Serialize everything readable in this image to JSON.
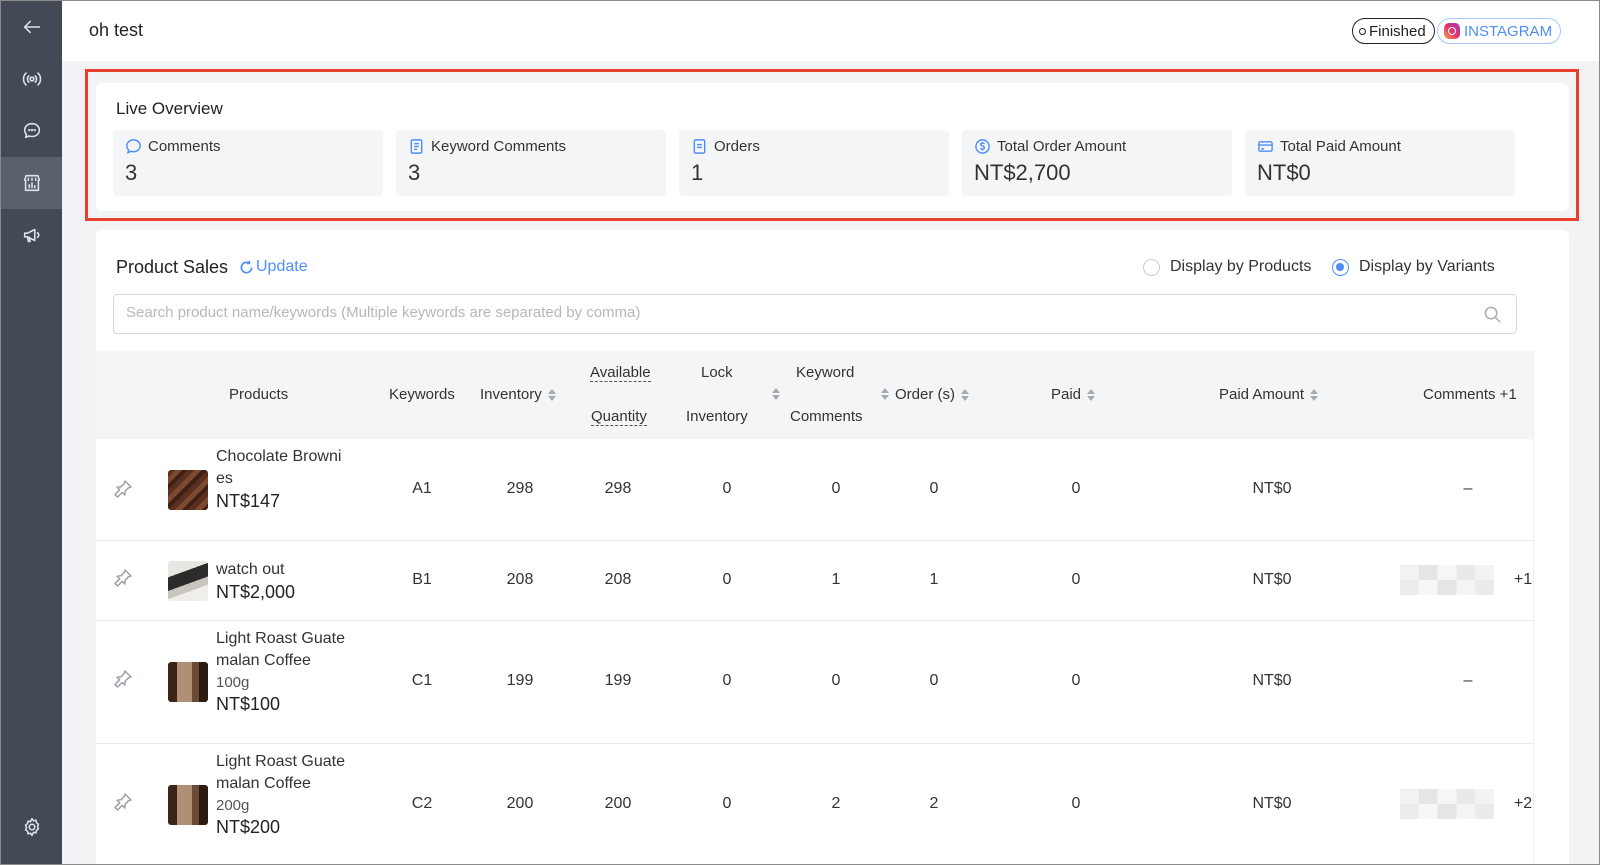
{
  "sidebar": {
    "items": [
      {
        "icon": "back-arrow-icon"
      },
      {
        "icon": "live-broadcast-icon"
      },
      {
        "icon": "chat-icon"
      },
      {
        "icon": "shop-analytics-icon",
        "active": true
      },
      {
        "icon": "megaphone-icon"
      },
      {
        "icon": "gear-icon"
      }
    ]
  },
  "header": {
    "title": "oh test",
    "status": "Finished",
    "platform": "INSTAGRAM"
  },
  "overview": {
    "title": "Live Overview",
    "stats": [
      {
        "label": "Comments",
        "value": "3",
        "icon": "comment-icon"
      },
      {
        "label": "Keyword Comments",
        "value": "3",
        "icon": "document-icon"
      },
      {
        "label": "Orders",
        "value": "1",
        "icon": "order-icon"
      },
      {
        "label": "Total Order Amount",
        "value": "NT$2,700",
        "icon": "dollar-icon"
      },
      {
        "label": "Total Paid Amount",
        "value": "NT$0",
        "icon": "card-icon"
      }
    ]
  },
  "sales": {
    "title": "Product Sales",
    "update_label": "Update",
    "display_by_products": "Display by Products",
    "display_by_variants": "Display by Variants",
    "selected_display": "variants",
    "search_placeholder": "Search product name/keywords (Multiple keywords are separated by comma)",
    "columns": {
      "products": "Products",
      "keywords": "Keywords",
      "inventory": "Inventory",
      "available": "Available",
      "quantity": "Quantity",
      "lock": "Lock",
      "lock_inventory": "Inventory",
      "keyword": "Keyword",
      "keyword_comments": "Comments",
      "orders": "Order (s)",
      "paid": "Paid",
      "paid_amount": "Paid Amount",
      "comments": "Comments +1"
    },
    "rows": [
      {
        "name_1": "Chocolate Browni",
        "name_2": "es",
        "variant": "",
        "price": "NT$147",
        "keyword": "A1",
        "inventory": "298",
        "available": "298",
        "lock": "0",
        "keyword_comments": "0",
        "orders": "0",
        "paid": "0",
        "paid_amount": "NT$0",
        "comments": "–"
      },
      {
        "name_1": "watch out",
        "name_2": "",
        "variant": "",
        "price": "NT$2,000",
        "keyword": "B1",
        "inventory": "208",
        "available": "208",
        "lock": "0",
        "keyword_comments": "1",
        "orders": "1",
        "paid": "0",
        "paid_amount": "NT$0",
        "comments": "+1"
      },
      {
        "name_1": "Light Roast Guate",
        "name_2": "malan Coffee",
        "variant": "100g",
        "price": "NT$100",
        "keyword": "C1",
        "inventory": "199",
        "available": "199",
        "lock": "0",
        "keyword_comments": "0",
        "orders": "0",
        "paid": "0",
        "paid_amount": "NT$0",
        "comments": "–"
      },
      {
        "name_1": "Light Roast Guate",
        "name_2": "malan Coffee",
        "variant": "200g",
        "price": "NT$200",
        "keyword": "C2",
        "inventory": "200",
        "available": "200",
        "lock": "0",
        "keyword_comments": "2",
        "orders": "2",
        "paid": "0",
        "paid_amount": "NT$0",
        "comments": "+2"
      }
    ]
  },
  "colors": {
    "sidebar": "#434a56",
    "accent": "#4c8ff8",
    "highlight": "#e8402e"
  }
}
